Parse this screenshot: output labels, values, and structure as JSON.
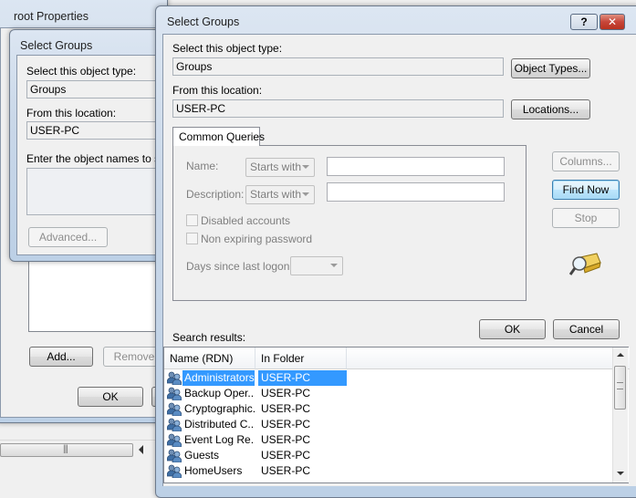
{
  "root_window": {
    "title": "root Properties",
    "ok_label": "OK",
    "add_label": "Add...",
    "remove_label": "Remove"
  },
  "bg_dialog": {
    "title": "Select Groups",
    "object_type_label": "Select this object type:",
    "object_type_value": "Groups",
    "location_label": "From this location:",
    "location_value": "USER-PC",
    "enter_names_label": "Enter the object names to sele",
    "advanced_label": "Advanced..."
  },
  "dialog": {
    "title": "Select Groups",
    "help_label": "?",
    "close_label": "✕",
    "object_type_label": "Select this object type:",
    "object_type_value": "Groups",
    "object_types_button": "Object Types...",
    "location_label": "From this location:",
    "location_value": "USER-PC",
    "locations_button": "Locations...",
    "common_queries_tab": "Common Queries",
    "name_label": "Name:",
    "name_mode": "Starts with",
    "description_label": "Description:",
    "description_mode": "Starts with",
    "disabled_accounts_label": "Disabled accounts",
    "non_expiring_label": "Non expiring password",
    "days_since_logon_label": "Days since last logon:",
    "columns_button": "Columns...",
    "find_now_button": "Find Now",
    "stop_button": "Stop",
    "ok_button": "OK",
    "cancel_button": "Cancel",
    "search_results_label": "Search results:",
    "results_headers": [
      "Name (RDN)",
      "In Folder"
    ],
    "results": [
      {
        "name": "Administrators",
        "folder": "USER-PC"
      },
      {
        "name": "Backup Oper...",
        "folder": "USER-PC"
      },
      {
        "name": "Cryptographic...",
        "folder": "USER-PC"
      },
      {
        "name": "Distributed C...",
        "folder": "USER-PC"
      },
      {
        "name": "Event Log Re...",
        "folder": "USER-PC"
      },
      {
        "name": "Guests",
        "folder": "USER-PC"
      },
      {
        "name": "HomeUsers",
        "folder": "USER-PC"
      }
    ],
    "selected_index": 0
  },
  "icons": {
    "group": "group-icon",
    "search": "search-flashlight-icon"
  },
  "colors": {
    "selection": "#3399ff",
    "title_glass": "#c9d7e8"
  }
}
